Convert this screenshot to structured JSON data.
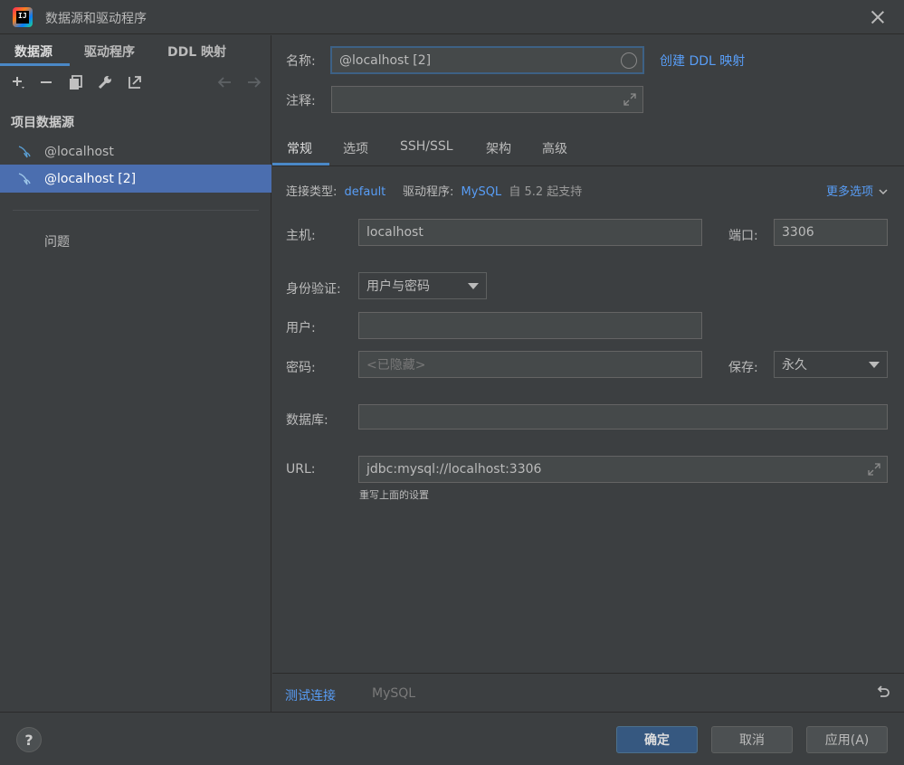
{
  "window": {
    "title": "数据源和驱动程序"
  },
  "sidebar": {
    "tabs": [
      "数据源",
      "驱动程序",
      "DDL 映射"
    ],
    "section_title": "项目数据源",
    "items": [
      "@localhost",
      "@localhost [2]"
    ],
    "problems": "问题"
  },
  "form": {
    "name_label": "名称:",
    "name_value": "@localhost [2]",
    "create_ddl_link": "创建 DDL 映射",
    "comment_label": "注释:",
    "comment_value": "",
    "tabs": [
      "常规",
      "选项",
      "SSH/SSL",
      "架构",
      "高级"
    ],
    "connection_type_label": "连接类型:",
    "connection_type_value": "default",
    "driver_label": "驱动程序:",
    "driver_value": "MySQL",
    "driver_note": "自 5.2 起支持",
    "more_options": "更多选项",
    "host_label": "主机:",
    "host_value": "localhost",
    "port_label": "端口:",
    "port_value": "3306",
    "auth_label": "身份验证:",
    "auth_value": "用户与密码",
    "user_label": "用户:",
    "user_value": "",
    "password_label": "密码:",
    "password_placeholder": "<已隐藏>",
    "save_label": "保存:",
    "save_value": "永久",
    "database_label": "数据库:",
    "database_value": "",
    "url_label": "URL:",
    "url_value": "jdbc:mysql://localhost:3306",
    "url_note": "重写上面的设置"
  },
  "bottom": {
    "test_connection": "测试连接",
    "driver_name": "MySQL"
  },
  "footer": {
    "help": "?",
    "ok": "确定",
    "cancel": "取消",
    "apply": "应用(A)"
  },
  "colors": {
    "accent": "#4a88c7",
    "selected_row": "#4b6eaf",
    "link": "#589df6",
    "background": "#3c3f41",
    "field": "#45494a",
    "primary_button": "#365880"
  }
}
